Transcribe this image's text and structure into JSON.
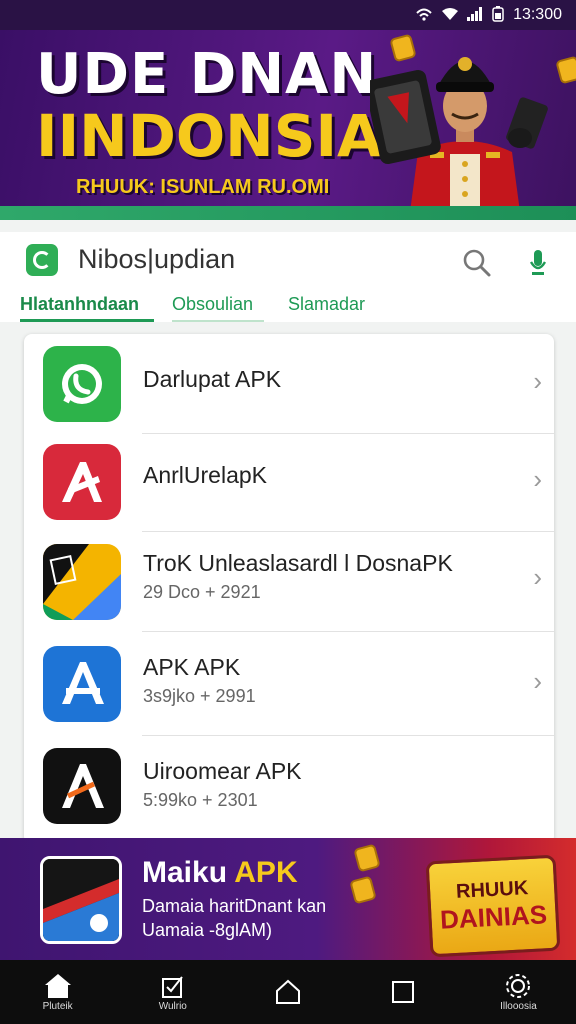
{
  "status_bar": {
    "time": "13:300"
  },
  "hero": {
    "title_line1": "UDE DNAN",
    "title_line2": "IINDONSIA",
    "subtitle": "RHUUK: ISUNLAM RU.OMI"
  },
  "search": {
    "query": "Nibos|updian",
    "tabs": [
      "Hlatanhndaan",
      "Obsoulian",
      "Slamadar"
    ]
  },
  "list": {
    "items": [
      {
        "title": "Darlupat APK",
        "subtitle": ""
      },
      {
        "title": "AnrlUrelapK",
        "subtitle": ""
      },
      {
        "title": "TroK Unleaslasardl l DosnaPK",
        "subtitle": "29 Dco + 2921"
      },
      {
        "title": "APK APK",
        "subtitle": "3s9jko + 2991"
      },
      {
        "title": "Uiroomear APK",
        "subtitle": "5:99ko + 2301"
      }
    ]
  },
  "promo": {
    "title_main": "Maiku",
    "title_accent": "APK",
    "line1": "Damaia haritDnant kan",
    "line2": "Uamaia -8glAM)",
    "badge_top": "RHUUK",
    "badge_main": "DAINIAS"
  },
  "nav": {
    "home_label": "Pluteik",
    "second_label": "Wulrio",
    "fifth_label": "Illooosia"
  },
  "colors": {
    "brand_green": "#1e9a55",
    "hero_purple": "#4a1575",
    "accent_yellow": "#f6c91c"
  }
}
